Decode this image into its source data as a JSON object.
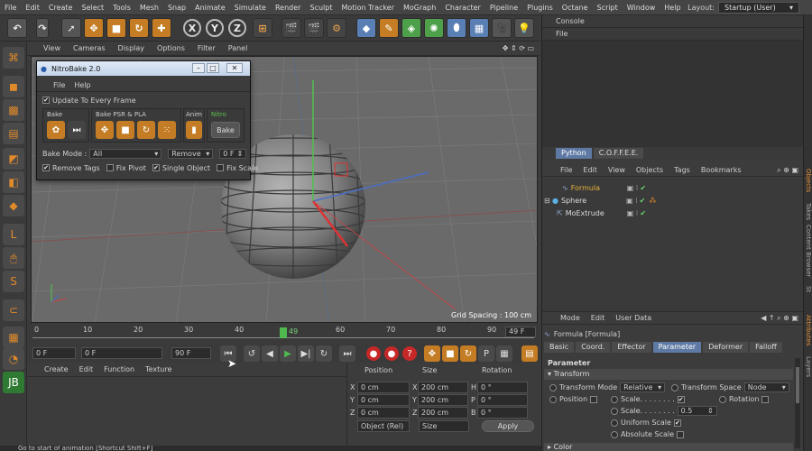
{
  "menubar": {
    "items": [
      "File",
      "Edit",
      "Create",
      "Select",
      "Tools",
      "Mesh",
      "Snap",
      "Animate",
      "Simulate",
      "Render",
      "Sculpt",
      "Motion Tracker",
      "MoGraph",
      "Character",
      "Pipeline",
      "Plugins",
      "Octane",
      "Script",
      "Window",
      "Help"
    ],
    "layout_label": "Layout:",
    "layout_value": "Startup (User)"
  },
  "toolbar": {
    "axis_x": "X",
    "axis_y": "Y",
    "axis_z": "Z"
  },
  "viewport": {
    "menu": [
      "View",
      "Cameras",
      "Display",
      "Options",
      "Filter",
      "Panel"
    ],
    "grid_spacing": "Grid Spacing : 100 cm"
  },
  "timeline": {
    "ticks": [
      "0",
      "10",
      "20",
      "30",
      "40",
      "49",
      "60",
      "70",
      "80",
      "90"
    ],
    "current_frame": "49",
    "end_frame": "49 F"
  },
  "transport": {
    "start_field": "0 F",
    "min_field": "0 F",
    "max_field": "90 F"
  },
  "bottom_panel": {
    "menu": [
      "Create",
      "Edit",
      "Function",
      "Texture"
    ]
  },
  "coord": {
    "headers": [
      "Position",
      "Size",
      "Rotation"
    ],
    "rows": [
      {
        "axis": "X",
        "pos": "0 cm",
        "size_axis": "X",
        "size": "200 cm",
        "rot_axis": "H",
        "rot": "0 °"
      },
      {
        "axis": "Y",
        "pos": "0 cm",
        "size_axis": "Y",
        "size": "200 cm",
        "rot_axis": "P",
        "rot": "0 °"
      },
      {
        "axis": "Z",
        "pos": "0 cm",
        "size_axis": "Z",
        "size": "200 cm",
        "rot_axis": "B",
        "rot": "0 °"
      }
    ],
    "mode_select": "Object (Rel)",
    "size_select": "Size",
    "apply": "Apply"
  },
  "status_text": "Go to start of animation [Shortcut Shift+F]",
  "console": {
    "title": "Console",
    "menu": "File",
    "tabs": [
      "Python",
      "C.O.F.F.E.E."
    ]
  },
  "objects": {
    "menu": [
      "File",
      "Edit",
      "View",
      "Objects",
      "Tags",
      "Bookmarks"
    ],
    "items": [
      {
        "name": "Formula",
        "indent": 1,
        "highlight": true
      },
      {
        "name": "Sphere",
        "indent": 0,
        "highlight": false
      },
      {
        "name": "MoExtrude",
        "indent": 2,
        "highlight": false
      }
    ]
  },
  "attributes": {
    "menu": [
      "Mode",
      "Edit",
      "User Data"
    ],
    "title": "Formula [Formula]",
    "tabs": [
      "Basic",
      "Coord.",
      "Effector",
      "Parameter",
      "Deformer",
      "Falloff"
    ],
    "active_tab": "Parameter",
    "section_parameter": "Parameter",
    "section_transform": "Transform",
    "transform_mode_label": "Transform Mode",
    "transform_mode_value": "Relative",
    "transform_space_label": "Transform Space",
    "transform_space_value": "Node",
    "position_label": "Position",
    "scale_label": "Scale. . . . . . . .",
    "rotation_label": "Rotation",
    "scale2_label": "Scale. . . . . . . .",
    "scale2_value": "0.5",
    "uniform_scale_label": "Uniform Scale",
    "absolute_scale_label": "Absolute Scale",
    "section_color": "Color"
  },
  "side_tabs": [
    "Objects",
    "Takes",
    "Content Browser",
    "St",
    "Attributes",
    "Layers"
  ],
  "dialog": {
    "title": "NitroBake 2.0",
    "menu": [
      "File",
      "Help"
    ],
    "update_label": "Update To Every Frame",
    "bake_group": "Bake",
    "psr_group": "Bake PSR & PLA",
    "anim_group": "Anim",
    "nitro_group": "Nitro",
    "bake_button": "Bake",
    "bake_mode_label": "Bake Mode :",
    "bake_mode_value": "All",
    "remove_value": "Remove",
    "frame_value": "0 F",
    "remove_tags": "Remove Tags",
    "fix_pivot": "Fix Pivot",
    "single_object": "Single Object",
    "fix_scale": "Fix Scale"
  },
  "colors": {
    "accent_orange": "#c47d24",
    "active_tab_blue": "#5e79a3",
    "playhead_green": "#4fb84f"
  }
}
